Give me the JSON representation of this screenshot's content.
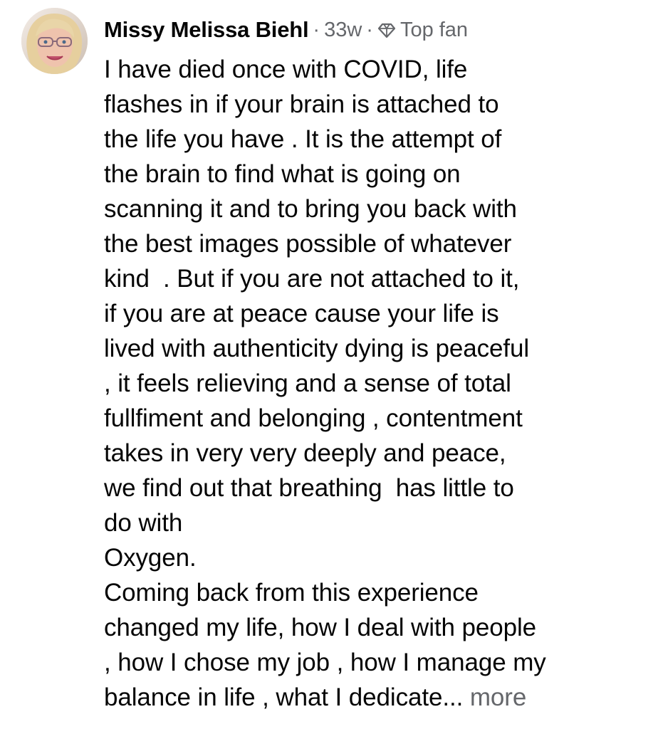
{
  "comment": {
    "author": "Missy Melissa Biehl",
    "time": "33w",
    "separator": "·",
    "badge": "Top fan",
    "badge_icon": "diamond-icon",
    "lines": [
      "I have died once with COVID, life",
      "flashes in if your brain is attached to",
      "the life you have . It is the attempt of",
      "the brain to find what is going on",
      "scanning it and to bring you back with",
      "the best images possible of whatever",
      "kind  . But if you are not attached to it,",
      "if you are at peace cause your life is",
      "lived with authenticity dying is peaceful",
      ", it feels relieving and a sense of total",
      "fullfiment and belonging , contentment",
      "takes in very very deeply and peace,",
      "we find out that breathing  has little to",
      "do with",
      "Oxygen.",
      "Coming back from this experience",
      "changed my life, how I deal with people",
      ", how I chose my job , how I manage my"
    ],
    "last_line": "balance in life , what I dedicate...",
    "more_label": "more"
  },
  "colors": {
    "text": "#050505",
    "secondary": "#65676b",
    "background": "#ffffff"
  }
}
